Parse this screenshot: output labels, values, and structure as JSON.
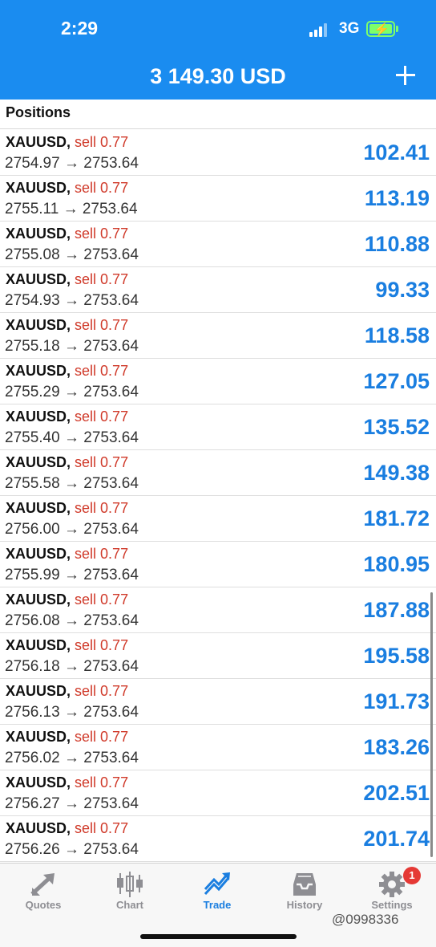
{
  "status_bar": {
    "time": "2:29",
    "network": "3G"
  },
  "header": {
    "balance": "3 149.30 USD"
  },
  "positions": {
    "title": "Positions",
    "arrow": "→",
    "items": [
      {
        "symbol": "XAUUSD",
        "side": "sell 0.77",
        "open": "2754.97",
        "current": "2753.64",
        "profit": "102.41"
      },
      {
        "symbol": "XAUUSD",
        "side": "sell 0.77",
        "open": "2755.11",
        "current": "2753.64",
        "profit": "113.19"
      },
      {
        "symbol": "XAUUSD",
        "side": "sell 0.77",
        "open": "2755.08",
        "current": "2753.64",
        "profit": "110.88"
      },
      {
        "symbol": "XAUUSD",
        "side": "sell 0.77",
        "open": "2754.93",
        "current": "2753.64",
        "profit": "99.33"
      },
      {
        "symbol": "XAUUSD",
        "side": "sell 0.77",
        "open": "2755.18",
        "current": "2753.64",
        "profit": "118.58"
      },
      {
        "symbol": "XAUUSD",
        "side": "sell 0.77",
        "open": "2755.29",
        "current": "2753.64",
        "profit": "127.05"
      },
      {
        "symbol": "XAUUSD",
        "side": "sell 0.77",
        "open": "2755.40",
        "current": "2753.64",
        "profit": "135.52"
      },
      {
        "symbol": "XAUUSD",
        "side": "sell 0.77",
        "open": "2755.58",
        "current": "2753.64",
        "profit": "149.38"
      },
      {
        "symbol": "XAUUSD",
        "side": "sell 0.77",
        "open": "2756.00",
        "current": "2753.64",
        "profit": "181.72"
      },
      {
        "symbol": "XAUUSD",
        "side": "sell 0.77",
        "open": "2755.99",
        "current": "2753.64",
        "profit": "180.95"
      },
      {
        "symbol": "XAUUSD",
        "side": "sell 0.77",
        "open": "2756.08",
        "current": "2753.64",
        "profit": "187.88"
      },
      {
        "symbol": "XAUUSD",
        "side": "sell 0.77",
        "open": "2756.18",
        "current": "2753.64",
        "profit": "195.58"
      },
      {
        "symbol": "XAUUSD",
        "side": "sell 0.77",
        "open": "2756.13",
        "current": "2753.64",
        "profit": "191.73"
      },
      {
        "symbol": "XAUUSD",
        "side": "sell 0.77",
        "open": "2756.02",
        "current": "2753.64",
        "profit": "183.26"
      },
      {
        "symbol": "XAUUSD",
        "side": "sell 0.77",
        "open": "2756.27",
        "current": "2753.64",
        "profit": "202.51"
      },
      {
        "symbol": "XAUUSD",
        "side": "sell 0.77",
        "open": "2756.26",
        "current": "2753.64",
        "profit": "201.74"
      }
    ]
  },
  "tabbar": {
    "tabs": [
      {
        "label": "Quotes",
        "icon": "quotes-arrows-icon"
      },
      {
        "label": "Chart",
        "icon": "candlestick-icon"
      },
      {
        "label": "Trade",
        "icon": "trade-trend-icon",
        "active": true
      },
      {
        "label": "History",
        "icon": "inbox-tray-icon"
      },
      {
        "label": "Settings",
        "icon": "gear-icon",
        "badge": "1"
      }
    ],
    "watermark": "@0998336"
  },
  "colors": {
    "header_blue": "#1a8cf0",
    "profit_blue": "#1a7ee0",
    "sell_red": "#d03a2a",
    "badge_red": "#e53935"
  }
}
